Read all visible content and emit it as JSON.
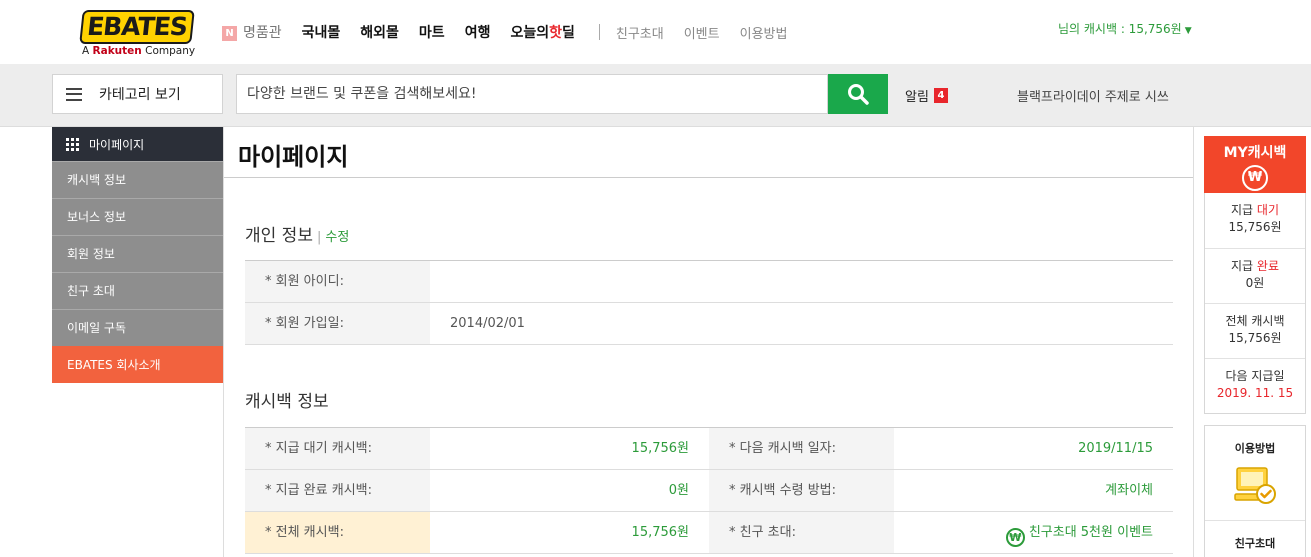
{
  "brand": {
    "logo_word": "EBATES",
    "logo_sub_prefix": "A ",
    "logo_sub_brand": "Rakuten",
    "logo_sub_suffix": " Company"
  },
  "gnb": {
    "luxury_badge": "N",
    "luxury": "명품관",
    "domestic": "국내몰",
    "overseas": "해외몰",
    "mart": "마트",
    "travel": "여행",
    "todays_deal_prefix": "오늘의",
    "todays_deal_hot": "핫",
    "todays_deal_suffix": "딜",
    "invite": "친구초대",
    "event": "이벤트",
    "howto": "이용방법",
    "user_cash": "님의 캐시백 : 15,756원"
  },
  "search": {
    "category_label": "카테고리 보기",
    "placeholder": "다양한 브랜드 및 쿠폰을 검색해보세요!",
    "alarm_label": "알림",
    "alarm_count": "4",
    "promo": "블랙프라이데이 주제로 시쓰"
  },
  "left_menu": {
    "title": "마이페이지",
    "items": [
      {
        "label": "캐시백 정보"
      },
      {
        "label": "보너스 정보"
      },
      {
        "label": "회원 정보"
      },
      {
        "label": "친구 초대"
      },
      {
        "label": "이메일 구독"
      },
      {
        "label": "EBATES 회사소개"
      }
    ]
  },
  "main": {
    "page_title": "마이페이지",
    "personal": {
      "title": "개인 정보",
      "edit": "수정",
      "rows": [
        {
          "label": "* 회원 아이디:",
          "value": ""
        },
        {
          "label": "* 회원 가입일:",
          "value": "2014/02/01"
        }
      ]
    },
    "cashback": {
      "title": "캐시백 정보",
      "rows": [
        {
          "label": "* 지급 대기 캐시백:",
          "value": "15,756원",
          "label2": "* 다음 캐시백 일자:",
          "value2": "2019/11/15"
        },
        {
          "label": "* 지급 완료 캐시백:",
          "value": "0원",
          "label2": "* 캐시백 수령 방법:",
          "value2": "계좌이체"
        },
        {
          "label": "* 전체 캐시백:",
          "value": "15,756원",
          "label2": "* 친구 초대:",
          "value2": "친구초대 5천원 이벤트"
        }
      ],
      "won_symbol": "₩"
    }
  },
  "right_side": {
    "title": "MY캐시백",
    "won_symbol": "₩",
    "pending_prefix": "지급 ",
    "pending_status": "대기",
    "pending_value": "15,756원",
    "done_prefix": "지급 ",
    "done_status": "완료",
    "done_value": "0원",
    "total_label": "전체 캐시백",
    "total_value": "15,756원",
    "next_label": "다음 지급일",
    "next_value": "2019. 11. 15",
    "guide": "이용방법",
    "invite": "친구초대"
  },
  "colors": {
    "green": "#1aa84b",
    "orange": "#f2623e",
    "red": "#e8262c",
    "dark": "#2b2f38"
  }
}
